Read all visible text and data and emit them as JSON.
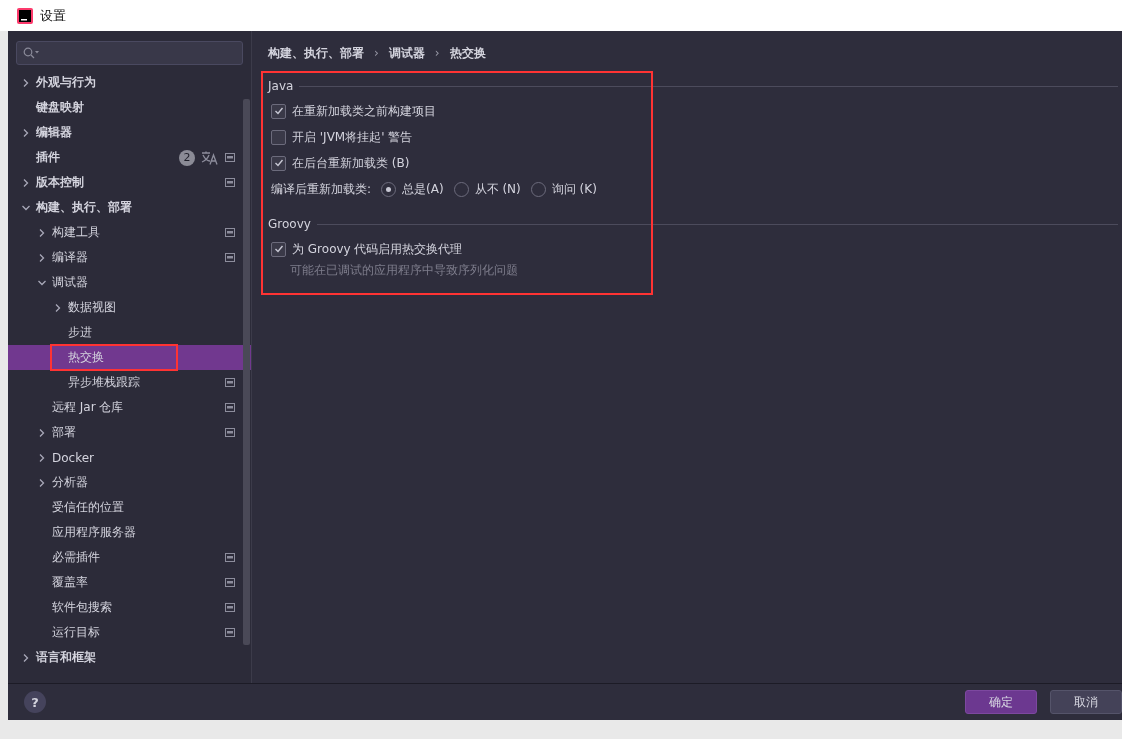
{
  "window": {
    "title": "设置"
  },
  "sidebar": {
    "items": [
      {
        "label": "外观与行为",
        "expanded": false,
        "selected": false
      },
      {
        "label": "键盘映射",
        "selected": false
      },
      {
        "label": "编辑器",
        "expanded": false,
        "selected": false
      },
      {
        "label": "插件",
        "badge": "2",
        "translate_icon": true,
        "project_scope": true,
        "selected": false
      },
      {
        "label": "版本控制",
        "expanded": false,
        "project_scope": true,
        "selected": false
      },
      {
        "label": "构建、执行、部署",
        "expanded": true,
        "selected": false,
        "children": [
          {
            "label": "构建工具",
            "expanded": false,
            "project_scope": true,
            "selected": false
          },
          {
            "label": "编译器",
            "expanded": false,
            "project_scope": true,
            "selected": false
          },
          {
            "label": "调试器",
            "expanded": true,
            "selected": false,
            "children": [
              {
                "label": "数据视图",
                "expanded": false,
                "selected": false
              },
              {
                "label": "步进",
                "selected": false
              },
              {
                "label": "热交换",
                "selected": true,
                "highlighted": true
              },
              {
                "label": "异步堆栈跟踪",
                "project_scope": true,
                "selected": false
              }
            ]
          },
          {
            "label": "远程 Jar 仓库",
            "project_scope": true,
            "selected": false
          },
          {
            "label": "部署",
            "expanded": false,
            "project_scope": true,
            "selected": false
          },
          {
            "label": "Docker",
            "expanded": false,
            "selected": false
          },
          {
            "label": "分析器",
            "expanded": false,
            "selected": false
          },
          {
            "label": "受信任的位置",
            "selected": false
          },
          {
            "label": "应用程序服务器",
            "selected": false
          },
          {
            "label": "必需插件",
            "project_scope": true,
            "selected": false
          },
          {
            "label": "覆盖率",
            "project_scope": true,
            "selected": false
          },
          {
            "label": "软件包搜索",
            "project_scope": true,
            "selected": false
          },
          {
            "label": "运行目标",
            "project_scope": true,
            "selected": false
          }
        ]
      },
      {
        "label": "语言和框架",
        "expanded": false,
        "selected": false
      }
    ]
  },
  "breadcrumb": {
    "separator": "›",
    "items": [
      "构建、执行、部署",
      "调试器",
      "热交换"
    ]
  },
  "settings_panel": {
    "highlighted": true,
    "sections": [
      {
        "title": "Java",
        "options": [
          {
            "kind": "checkbox",
            "label": "在重新加载类之前构建项目",
            "checked": true
          },
          {
            "kind": "checkbox",
            "label": "开启 'JVM将挂起' 警告",
            "checked": false
          },
          {
            "kind": "checkbox",
            "label": "在后台重新加载类 (B)",
            "checked": true
          },
          {
            "kind": "radio",
            "label": "编译后重新加载类:",
            "choices": [
              {
                "label": "总是(A)",
                "selected": true
              },
              {
                "label": "从不 (N)",
                "selected": false
              },
              {
                "label": "询问 (K)",
                "selected": false
              }
            ]
          }
        ]
      },
      {
        "title": "Groovy",
        "options": [
          {
            "kind": "checkbox",
            "label": "为 Groovy 代码启用热交换代理",
            "checked": true,
            "hint": "可能在已调试的应用程序中导致序列化问题"
          }
        ]
      }
    ]
  },
  "footer": {
    "help": "?",
    "buttons": [
      {
        "label": "确定",
        "primary": true
      },
      {
        "label": "取消",
        "primary": false
      }
    ]
  }
}
